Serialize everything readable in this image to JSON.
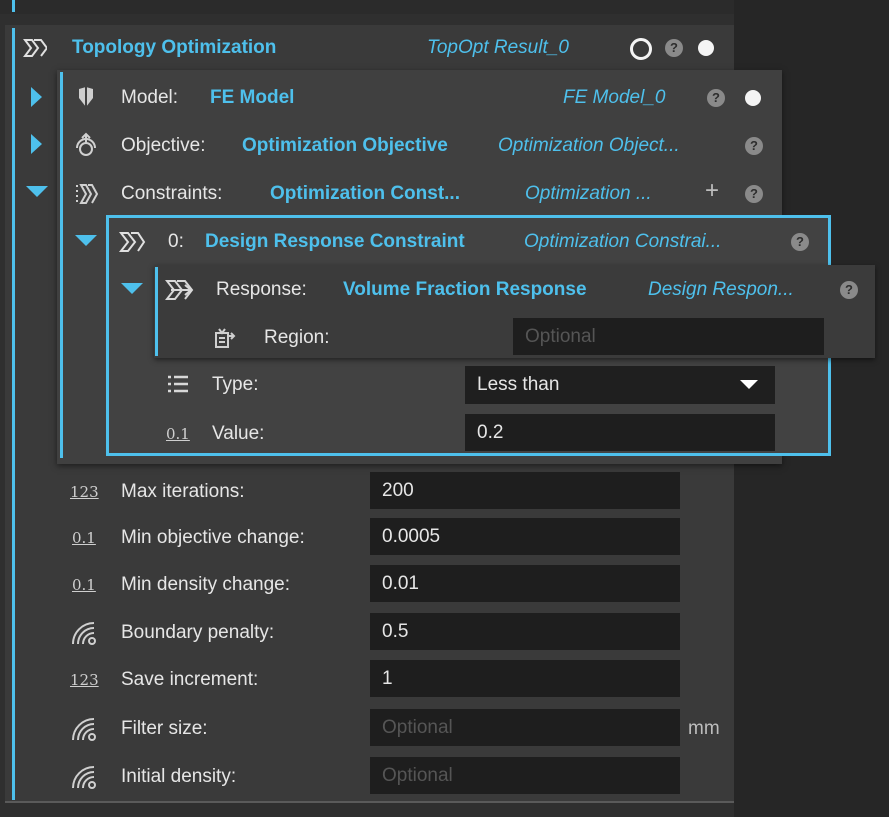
{
  "topopt": {
    "title": "Topology Optimization",
    "result": "TopOpt Result_0"
  },
  "model": {
    "label": "Model:",
    "value": "FE Model",
    "ref": "FE Model_0"
  },
  "objective": {
    "label": "Objective:",
    "value": "Optimization Objective",
    "ref": "Optimization Object..."
  },
  "constraints": {
    "label": "Constraints:",
    "value": "Optimization Const...",
    "ref": "Optimization ...",
    "add": "+"
  },
  "constraint0": {
    "index": "0:",
    "value": "Design Response Constraint",
    "ref": "Optimization Constrai..."
  },
  "response": {
    "label": "Response:",
    "value": "Volume Fraction Response",
    "ref": "Design Respon..."
  },
  "region": {
    "label": "Region:",
    "placeholder": "Optional"
  },
  "type": {
    "label": "Type:",
    "value": "Less than"
  },
  "value": {
    "label": "Value:",
    "value": "0.2"
  },
  "params": [
    {
      "icon": "123",
      "label": "Max iterations:",
      "value": "200"
    },
    {
      "icon": "0.1",
      "label": "Min objective change:",
      "value": "0.0005"
    },
    {
      "icon": "0.1",
      "label": "Min density change:",
      "value": "0.01"
    },
    {
      "icon": "wave",
      "label": "Boundary penalty:",
      "value": "0.5"
    },
    {
      "icon": "123",
      "label": "Save increment:",
      "value": "1"
    },
    {
      "icon": "wave",
      "label": "Filter size:",
      "placeholder": "Optional",
      "unit": "mm"
    },
    {
      "icon": "wave",
      "label": "Initial density:",
      "placeholder": "Optional"
    }
  ],
  "help_glyph": "?",
  "colors": {
    "accent": "#4ec0ec",
    "panel": "#3a3a3a",
    "field": "#1e1e1e"
  }
}
